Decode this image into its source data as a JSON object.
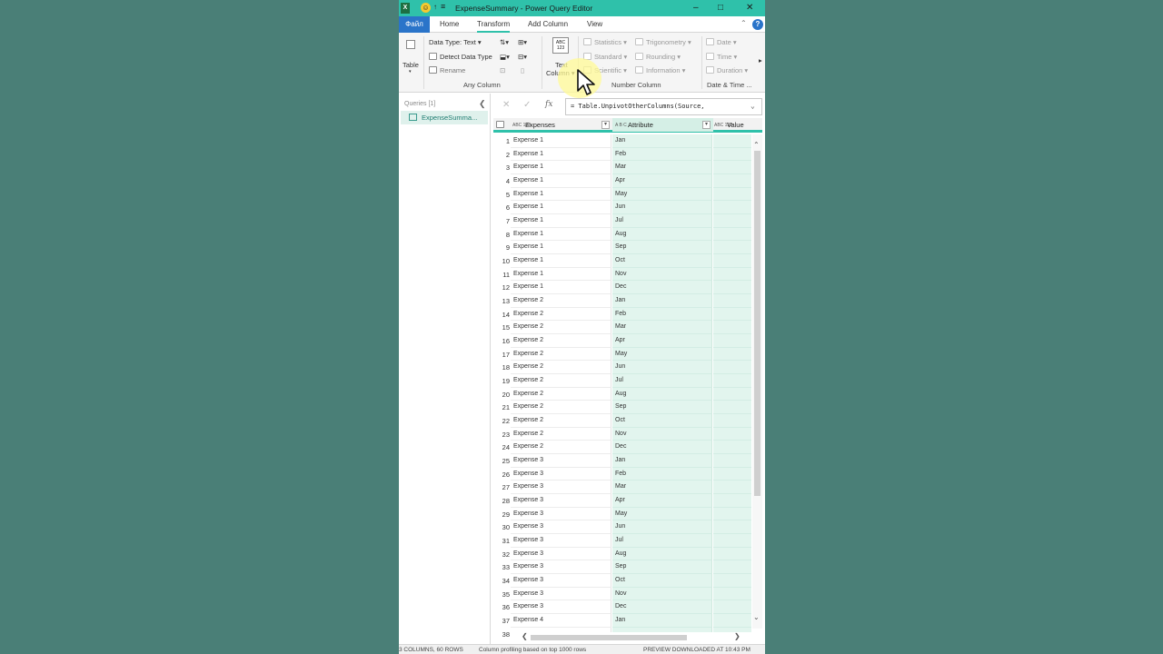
{
  "window": {
    "app_badge": "X",
    "title": "ExpenseSummary - Power Query Editor",
    "qat_undo": "↑",
    "qat_more": "≡",
    "minimize": "–",
    "maximize": "□",
    "close": "✕"
  },
  "tabs": {
    "file": "Файл",
    "items": [
      "Home",
      "Transform",
      "Add Column",
      "View"
    ],
    "active": "Transform",
    "collapse": "⌃",
    "help": "?"
  },
  "ribbon": {
    "table": "Table",
    "data_type": "Data Type: Text ▾",
    "detect_data_type": "Detect Data Type",
    "rename": "Rename",
    "any_column": "Any Column",
    "text_column_line1": "Text",
    "text_column_line2": "Column ▾",
    "statistics": "Statistics ▾",
    "standard": "Standard ▾",
    "scientific": "Scientific ▾",
    "trigonometry": "Trigonometry ▾",
    "rounding": "Rounding ▾",
    "information": "Information ▾",
    "number_column": "Number Column",
    "date": "Date ▾",
    "time": "Time ▾",
    "duration": "Duration ▾",
    "date_time": "Date & Time ...",
    "abc123": "ABC 123",
    "more": "▸"
  },
  "queries": {
    "header": "Queries [1]",
    "collapse": "❮",
    "item": "ExpenseSumma..."
  },
  "formula": {
    "cancel": "✕",
    "confirm": "✓",
    "fx": "fx",
    "text": "= Table.UnpivotOtherColumns(Source,",
    "expand": "⌄"
  },
  "columns": [
    {
      "type": "ABC 123",
      "name": "Expenses",
      "filter": "▾"
    },
    {
      "type": "A B C",
      "name": "Attribute",
      "filter": "▾"
    },
    {
      "type": "ABC 123",
      "name": "Value"
    }
  ],
  "rows": [
    [
      "1",
      "Expense 1",
      "Jan"
    ],
    [
      "2",
      "Expense 1",
      "Feb"
    ],
    [
      "3",
      "Expense 1",
      "Mar"
    ],
    [
      "4",
      "Expense 1",
      "Apr"
    ],
    [
      "5",
      "Expense 1",
      "May"
    ],
    [
      "6",
      "Expense 1",
      "Jun"
    ],
    [
      "7",
      "Expense 1",
      "Jul"
    ],
    [
      "8",
      "Expense 1",
      "Aug"
    ],
    [
      "9",
      "Expense 1",
      "Sep"
    ],
    [
      "10",
      "Expense 1",
      "Oct"
    ],
    [
      "11",
      "Expense 1",
      "Nov"
    ],
    [
      "12",
      "Expense 1",
      "Dec"
    ],
    [
      "13",
      "Expense 2",
      "Jan"
    ],
    [
      "14",
      "Expense 2",
      "Feb"
    ],
    [
      "15",
      "Expense 2",
      "Mar"
    ],
    [
      "16",
      "Expense 2",
      "Apr"
    ],
    [
      "17",
      "Expense 2",
      "May"
    ],
    [
      "18",
      "Expense 2",
      "Jun"
    ],
    [
      "19",
      "Expense 2",
      "Jul"
    ],
    [
      "20",
      "Expense 2",
      "Aug"
    ],
    [
      "21",
      "Expense 2",
      "Sep"
    ],
    [
      "22",
      "Expense 2",
      "Oct"
    ],
    [
      "23",
      "Expense 2",
      "Nov"
    ],
    [
      "24",
      "Expense 2",
      "Dec"
    ],
    [
      "25",
      "Expense 3",
      "Jan"
    ],
    [
      "26",
      "Expense 3",
      "Feb"
    ],
    [
      "27",
      "Expense 3",
      "Mar"
    ],
    [
      "28",
      "Expense 3",
      "Apr"
    ],
    [
      "29",
      "Expense 3",
      "May"
    ],
    [
      "30",
      "Expense 3",
      "Jun"
    ],
    [
      "31",
      "Expense 3",
      "Jul"
    ],
    [
      "32",
      "Expense 3",
      "Aug"
    ],
    [
      "33",
      "Expense 3",
      "Sep"
    ],
    [
      "34",
      "Expense 3",
      "Oct"
    ],
    [
      "35",
      "Expense 3",
      "Nov"
    ],
    [
      "36",
      "Expense 3",
      "Dec"
    ],
    [
      "37",
      "Expense 4",
      "Jan"
    ],
    [
      "38",
      "",
      ""
    ]
  ],
  "scroll": {
    "up": "⌃",
    "down": "⌄",
    "left": "❮",
    "right": "❯"
  },
  "status": {
    "columns": "3 COLUMNS, 60 ROWS",
    "profiling": "Column profiling based on top 1000 rows",
    "preview": "PREVIEW DOWNLOADED AT 10:43 PM"
  },
  "colors": {
    "accent": "#2fc1aa",
    "file_tab": "#2a74c9",
    "selected_column": "#e2f5ee",
    "background": "#4a7f77"
  }
}
